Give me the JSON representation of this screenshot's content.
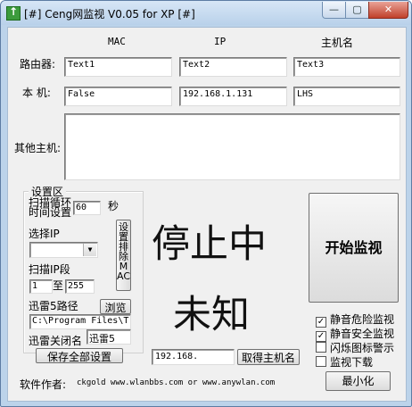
{
  "window": {
    "title": "[#] Ceng网监视 V0.05 for XP [#]",
    "min_glyph": "—",
    "max_glyph": "▢",
    "close_glyph": "✕"
  },
  "columns": {
    "mac": "MAC",
    "ip": "IP",
    "host": "主机名"
  },
  "router": {
    "label": "路由器:",
    "mac": "Text1",
    "ip": "Text2",
    "host": "Text3"
  },
  "local": {
    "label": "本 机:",
    "mac": "False",
    "ip": "192.168.1.131",
    "host": "LHS"
  },
  "others": {
    "label": "其他主机:",
    "value": ""
  },
  "settings": {
    "group_title": "设置区",
    "scan_interval_label": "扫描循环\n时间设置",
    "scan_interval_value": "60",
    "seconds_unit": "秒",
    "select_ip_label": "选择IP",
    "select_ip_value": "",
    "set_exclude_mac_button": "设置排除MAC",
    "scan_range_label": "扫描IP段",
    "range_from": "1",
    "range_to_label": "至",
    "range_to": "255",
    "thunder_path_label": "迅雷5路径",
    "browse_button": "浏览",
    "thunder_path_value": "C:\\Program Files\\T",
    "close_name_label": "迅雷关闭名",
    "close_name_value": "迅雷5",
    "save_all_button": "保存全部设置"
  },
  "status": {
    "line1": "停止中",
    "line2": "未知"
  },
  "start_monitor_button": "开始监视",
  "ip_prefix_value": "192.168.",
  "get_hostname_button": "取得主机名",
  "checkboxes": [
    {
      "label": "静音危险监视",
      "checked": true
    },
    {
      "label": "静音安全监视",
      "checked": true
    },
    {
      "label": "闪烁图标警示",
      "checked": false
    },
    {
      "label": "监视下载",
      "checked": false
    }
  ],
  "minimize_button": "最小化",
  "footer": {
    "author_label": "软件作者:",
    "author_text": "ckgold    www.wlanbbs.com or www.anywlan.com"
  }
}
